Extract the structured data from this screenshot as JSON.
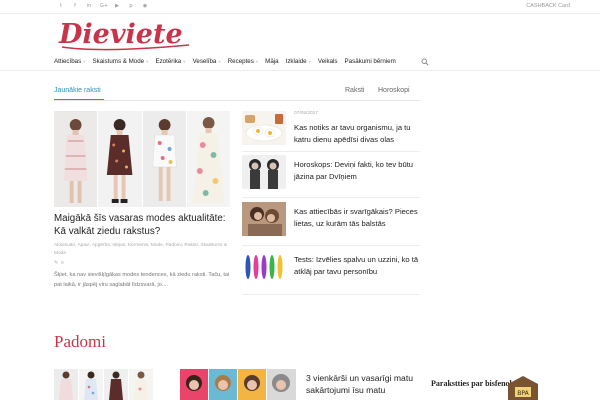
{
  "topbar": {
    "social_icons": [
      "twitter-icon",
      "facebook-icon",
      "linkedin-icon",
      "google-plus-icon",
      "youtube-icon",
      "pinterest-icon",
      "rss-icon"
    ],
    "social_glyphs": [
      "t",
      "f",
      "in",
      "G+",
      "▶",
      "p",
      "◉"
    ],
    "cashback": "CASHBACK Card"
  },
  "logo": {
    "text": "Dieviete",
    "color": "#c8354b"
  },
  "nav": {
    "items": [
      {
        "label": "Attiecības",
        "has_dropdown": true
      },
      {
        "label": "Skaistums & Mode",
        "has_dropdown": true
      },
      {
        "label": "Ezotērika",
        "has_dropdown": true
      },
      {
        "label": "Veselība",
        "has_dropdown": true
      },
      {
        "label": "Receptes",
        "has_dropdown": true
      },
      {
        "label": "Māja",
        "has_dropdown": false
      },
      {
        "label": "Izklaide",
        "has_dropdown": true
      },
      {
        "label": "Veikals",
        "has_dropdown": false
      },
      {
        "label": "Pasākumi bērniem",
        "has_dropdown": false
      }
    ],
    "caret": "˅"
  },
  "tabs": {
    "active": "Jaunākie raksti",
    "others": [
      "Raksti",
      "Horoskopi"
    ],
    "accent": "#2a93b6"
  },
  "feature": {
    "title": "Maigākā šīs vasaras modes aktualitāte: Kā valkāt ziedu rakstus?",
    "tags": "Aksesuāri, Apavi, Apģērbs, Idejas, Kermenis, Mode, Padomi, Raksti, Skaistums & Mode",
    "comments_icon": "comment-icon",
    "comments": "0",
    "excerpt": "Šķiet, ka nav sievišķīgākas modes tendences, kā ziedu raksti. Taču, tai pat laikā, ir jāspēj viru saglabāt līdzsvarā, jo...."
  },
  "side_articles": [
    {
      "date": "07/05/2017",
      "title": "Kas notiks ar tavu organismu, ja tu katru dienu apēdīsi divas olas"
    },
    {
      "date": "",
      "title": "Horoskops: Deviņi fakti, ko tev būtu jāzina par Dvīņiem"
    },
    {
      "date": "",
      "title": "Kas attiecībās ir svarīgākais? Pieces lietas, uz kurām tās balstās"
    },
    {
      "date": "",
      "title": "Tests: Izvēlies spalvu un uzzini, ko tā atklāj par tavu personību"
    }
  ],
  "padomi": {
    "title": "Padomi",
    "story_title": "3 vienkārši un vasarīgi matu sakārtojumi īsu matu"
  },
  "ad": {
    "text": "Parakstties par bisfenolu A"
  }
}
